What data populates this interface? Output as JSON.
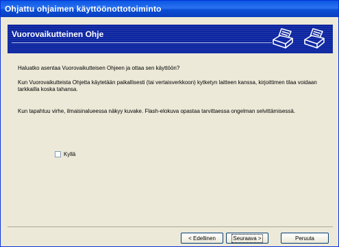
{
  "window": {
    "title": "Ohjattu ohjaimen käyttöönottotoiminto"
  },
  "header": {
    "title": "Vuorovaikutteinen Ohje",
    "icons": [
      "printer-icon",
      "printer-icon"
    ]
  },
  "content": {
    "question": "Haluatko asentaa Vuorovaikutteisen Ohjeen ja ottaa sen käyttöön?",
    "para1": "Kun Vuorovaikutteista Ohjetta käytetään paikallisesti (tai vertaisverkkoon) kytketyn laitteen kanssa, kirjoittimen tilaa voidaan tarkkailla koska tahansa.",
    "para2": "Kun tapahtuu virhe, ilmaisinalueessa näkyy kuvake. Flash-elokuva opastaa tarvittaessa ongelman selvittämisessä.",
    "checkbox": {
      "label": "Kyllä",
      "checked": false
    }
  },
  "footer": {
    "back_label": "< Edellinen",
    "next_label": "Seuraava >",
    "cancel_label": "Peruuta"
  }
}
